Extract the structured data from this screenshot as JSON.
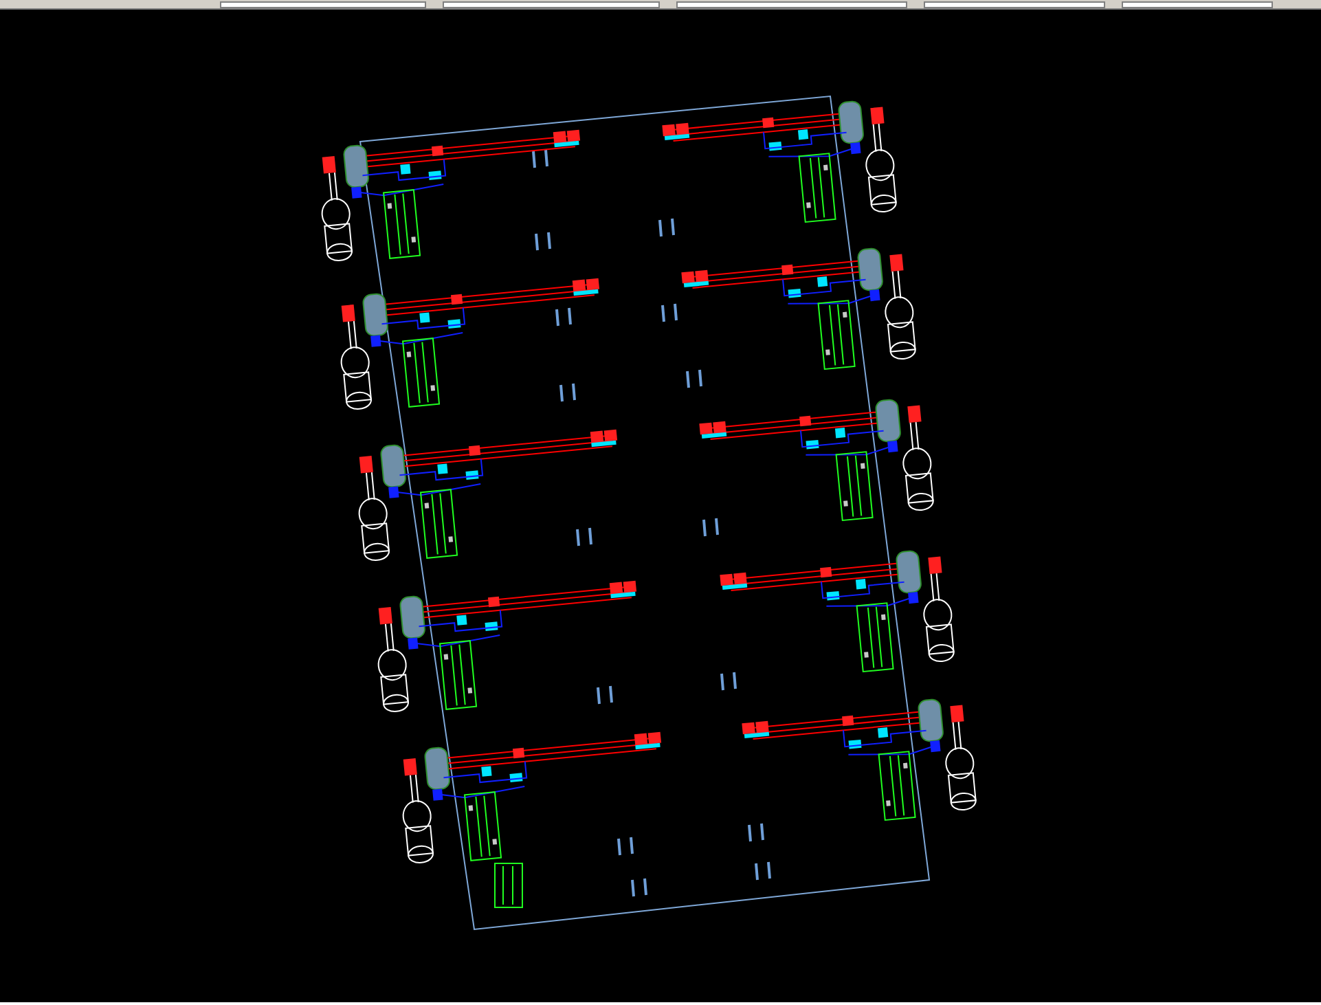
{
  "toolbar": {
    "fields": [
      {
        "kind": "field"
      },
      {
        "kind": "field"
      },
      {
        "kind": "field"
      },
      {
        "kind": "field"
      },
      {
        "kind": "field"
      }
    ]
  },
  "viewport": {
    "kind": "cad",
    "units": [
      {
        "kind": "left"
      },
      {
        "kind": "left"
      },
      {
        "kind": "left"
      },
      {
        "kind": "left"
      },
      {
        "kind": "left"
      },
      {
        "kind": "right"
      },
      {
        "kind": "right"
      },
      {
        "kind": "right"
      },
      {
        "kind": "right"
      },
      {
        "kind": "right"
      }
    ]
  }
}
